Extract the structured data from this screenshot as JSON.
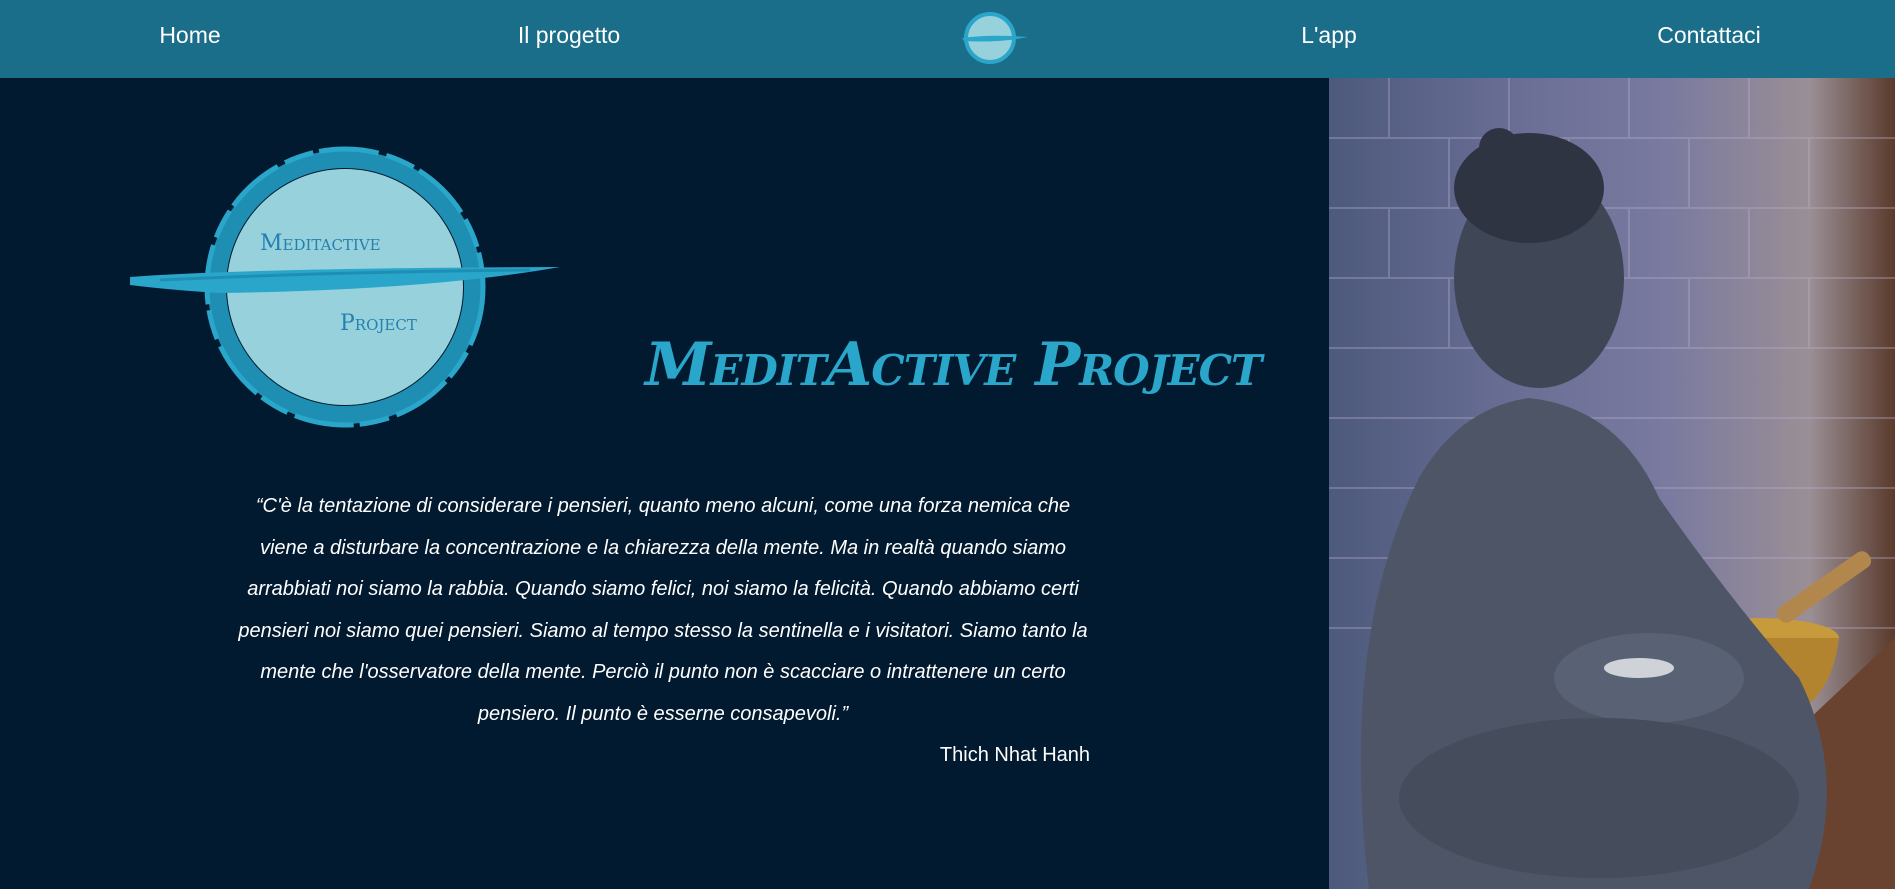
{
  "nav": {
    "links": [
      "Home",
      "Il progetto",
      "L'app",
      "Contattaci"
    ],
    "logo_icon": "meditactive-logo-icon"
  },
  "hero": {
    "logo": {
      "line1": "Meditactive",
      "line2": "Project"
    },
    "title": "MeditActive Project",
    "quote": "“C'è la tentazione di considerare i pensieri, quanto meno alcuni, come una forza nemica che viene a disturbare la concentrazione e la chiarezza della mente. Ma in realtà quando siamo arrabbiati noi siamo la rabbia. Quando siamo felici, noi siamo la felicità. Quando abbiamo certi pensieri noi siamo quei pensieri. Siamo al tempo stesso la sentinella e i visitatori. Siamo tanto la mente che l'osservatore della mente. Perciò il punto non è scacciare o intrattenere un certo pensiero. Il punto è esserne consapevoli.”",
    "author": "Thich Nhat Hanh"
  },
  "photo": {
    "subject": "buddha-statue-image"
  },
  "colors": {
    "navbar": "#1a6e8a",
    "background": "#021a30",
    "accent": "#2aa6cb",
    "logo_fill": "#97d2dc"
  }
}
